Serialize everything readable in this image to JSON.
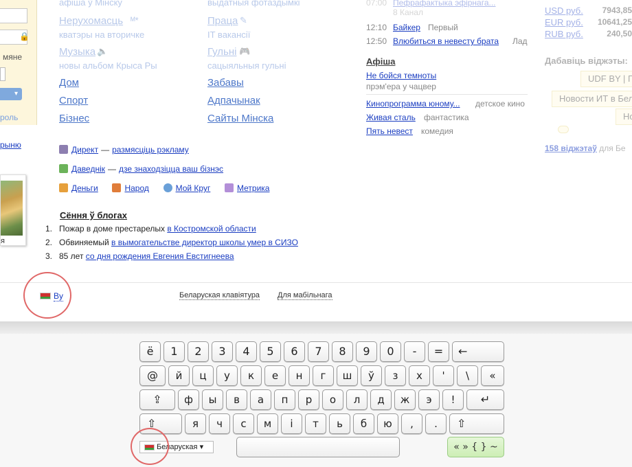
{
  "left": {
    "remember": "мяне",
    "forgot": "роль",
    "register": "рыню",
    "photo_caption": "я"
  },
  "services": {
    "col1": [
      {
        "label": "Нерухомасць",
        "sub": "кватэры на вторичке",
        "faded": true
      },
      {
        "label": "Музыка",
        "sub": "новы альбом Крыса Ры",
        "faded": true
      },
      {
        "label": "Дом",
        "sub": "",
        "faded": false
      },
      {
        "label": "Спорт",
        "sub": "",
        "faded": false
      },
      {
        "label": "Бізнес",
        "sub": "",
        "faded": false
      }
    ],
    "col2": [
      {
        "label": "Праца",
        "sub": "IT вакансії",
        "faded": true
      },
      {
        "label": "Гульні",
        "sub": "сацыяльныя гульні",
        "faded": true
      },
      {
        "label": "Забавы",
        "sub": "",
        "faded": false
      },
      {
        "label": "Адпачынак",
        "sub": "",
        "faded": false
      },
      {
        "label": "Сайты Мінска",
        "sub": "",
        "faded": false
      }
    ],
    "top_cut_1": "афіша ў Мінску",
    "top_cut_2": "выдатныя фотаздымкі"
  },
  "tv": {
    "rows": [
      {
        "time": "07:00",
        "show": "Пефрафактыка эфірнага...",
        "channel": "8 Канал"
      },
      {
        "time": "12:10",
        "show": "Байкер",
        "channel": "Первый"
      },
      {
        "time": "12:50",
        "show": "Влюбиться в невесту брата",
        "channel": "Лад"
      }
    ]
  },
  "afisha": {
    "title": "Афіша",
    "premiere_title": "Не бойся темноты",
    "premiere_note": "прэм'ера у чацвер",
    "movies": [
      {
        "title": "Кинопрограмма юному...",
        "genre": "детское кино"
      },
      {
        "title": "Живая сталь",
        "genre": "фантастика"
      },
      {
        "title": "Пять невест",
        "genre": "комедия"
      }
    ]
  },
  "currency": {
    "rows": [
      {
        "name": "USD руб.",
        "value": "7943,85"
      },
      {
        "name": "EUR руб.",
        "value": "10641,25"
      },
      {
        "name": "RUB руб.",
        "value": "240,50"
      }
    ]
  },
  "widgets": {
    "title": "Дабавіць віджэты:",
    "items": [
      "UDF BY | Г",
      "Новости ИТ в Бел",
      "Но"
    ],
    "count_link": "158 віджэтаў",
    "count_rest": " для Бе"
  },
  "promo": [
    {
      "name": "Директ",
      "tail": "размясціць рэкламу",
      "color": "#8d7fb0"
    },
    {
      "name": "Даведнік",
      "tail": "дзе знаходзіцца ваш бізнэс",
      "color": "#6cb35a"
    }
  ],
  "promo_row3": [
    {
      "name": "Деньги",
      "color": "#e6a03c"
    },
    {
      "name": "Народ",
      "color": "#e07d3a"
    },
    {
      "name": "Мой Круг",
      "color": "#6aa0d8"
    },
    {
      "name": "Метрика",
      "color": "#b38fd8"
    }
  ],
  "blogs": {
    "title": "Сёння ў блогах",
    "items": [
      {
        "num": "1.",
        "text": "Пожар в доме престарелых ",
        "link": "в Костромской области"
      },
      {
        "num": "2.",
        "text": "Обвиняемый ",
        "link": "в вымогательстве директор школы умер в СИЗО"
      },
      {
        "num": "3.",
        "text": "85 лет ",
        "link": "со дня рождения Евгения Евстигнеева"
      }
    ]
  },
  "footer": {
    "lang": "By",
    "keyboard_link": "Беларуская клавіятура",
    "mobile_link": "Для мабільнага"
  },
  "keyboard": {
    "row1": [
      "ё",
      "1",
      "2",
      "3",
      "4",
      "5",
      "6",
      "7",
      "8",
      "9",
      "0",
      "-",
      "=",
      "←"
    ],
    "row2": [
      "@",
      "й",
      "ц",
      "у",
      "к",
      "е",
      "н",
      "г",
      "ш",
      "ў",
      "з",
      "х",
      "'",
      "\\",
      "«"
    ],
    "row3": [
      "⇪",
      "ф",
      "ы",
      "в",
      "а",
      "п",
      "р",
      "о",
      "л",
      "д",
      "ж",
      "э",
      "!",
      "↵"
    ],
    "row4": [
      "⇧",
      "я",
      "ч",
      "с",
      "м",
      "і",
      "т",
      "ь",
      "б",
      "ю",
      ",",
      ".",
      "⇧"
    ],
    "lang_select": "Беларуская ▾",
    "symbols": "« » { } ~"
  }
}
